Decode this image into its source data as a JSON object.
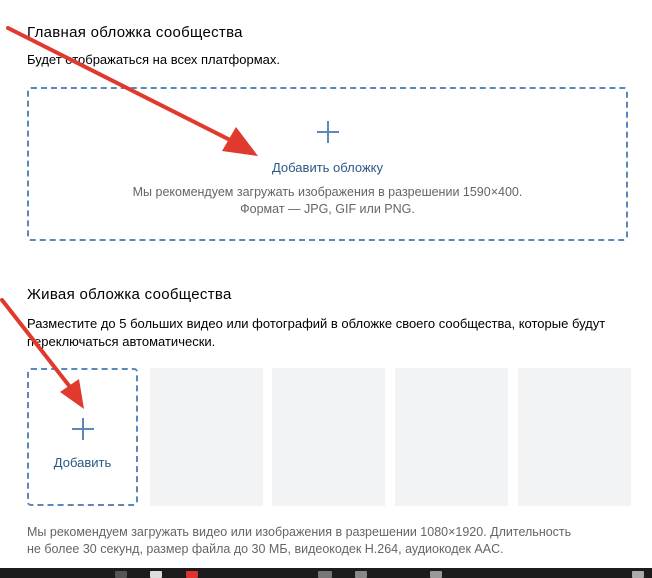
{
  "main_cover": {
    "title": "Главная обложка сообщества",
    "subtitle": "Будет отображаться на всех платформах.",
    "add_label": "Добавить обложку",
    "hint_line1": "Мы рекомендуем загружать изображения в разрешении 1590×400.",
    "hint_line2": "Формат — JPG, GIF или PNG."
  },
  "live_cover": {
    "title": "Живая обложка сообщества",
    "description": "Разместите до 5 больших видео или фотографий в обложке своего сообщества, которые будут переключаться автоматически.",
    "add_label": "Добавить",
    "hint_line1": "Мы рекомендуем загружать видео или изображения в разрешении 1080×1920. Длительность",
    "hint_line2": "не более 30 секунд, размер файла до 30 МБ, видеокодек H.264, аудиокодек AAC."
  },
  "colors": {
    "accent": "#5b88b8",
    "link": "#2a5885",
    "hint": "#656565",
    "slot_bg": "#f2f3f5",
    "annotation_arrow": "#e03a2f"
  },
  "icons": {
    "add": "plus-icon",
    "annotation": "red-arrow"
  }
}
